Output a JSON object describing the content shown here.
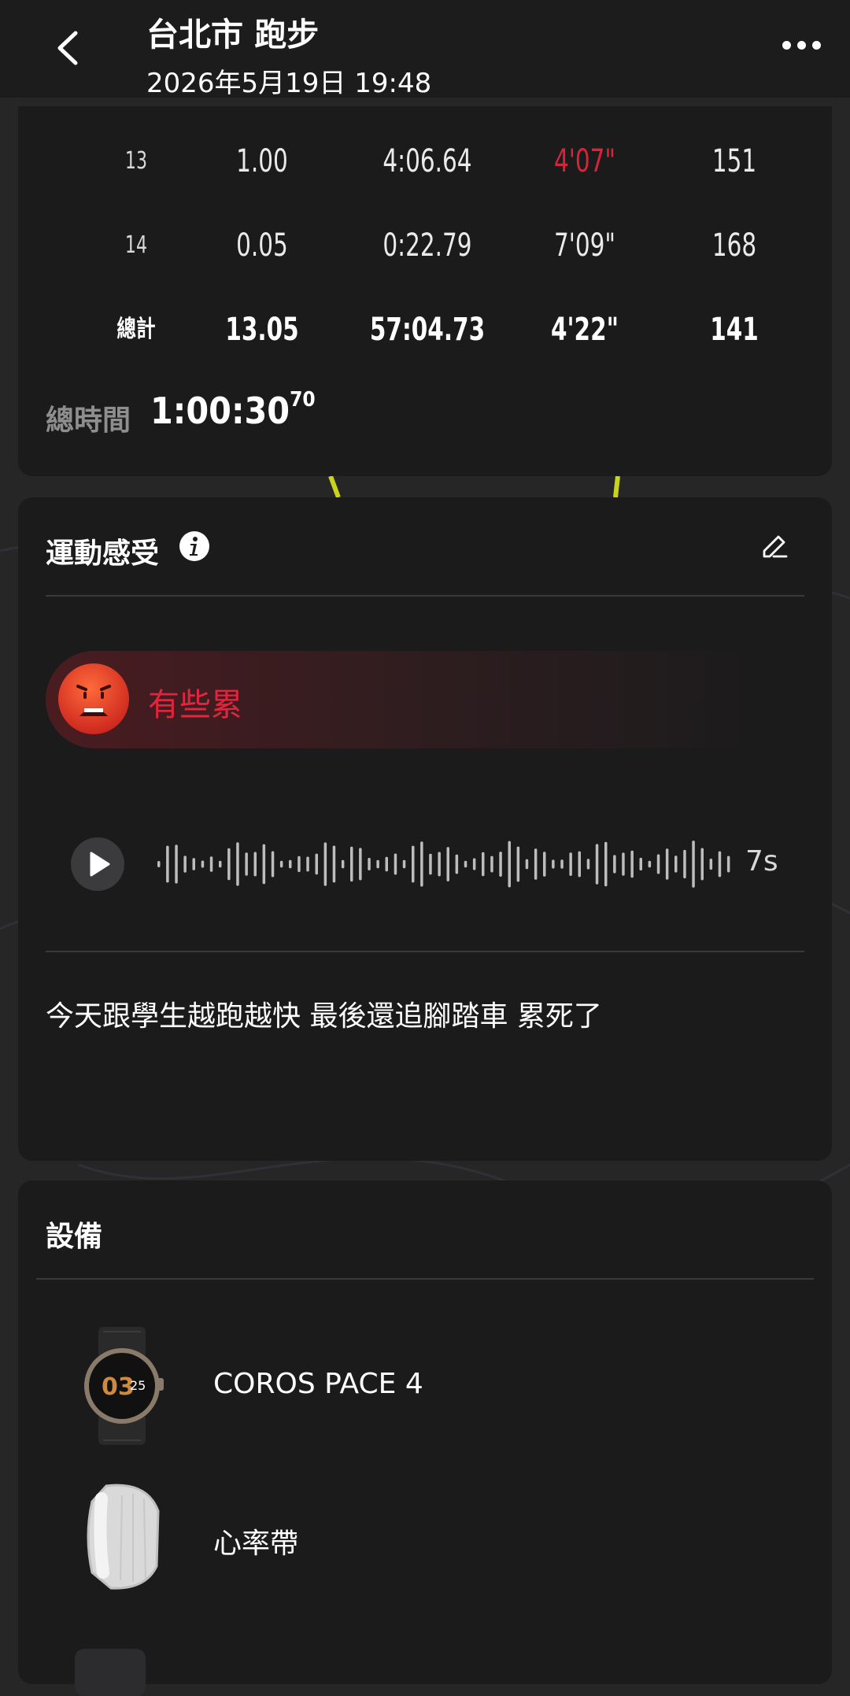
{
  "header": {
    "title": "台北市 跑步",
    "subtitle": "2026年5月19日 19:48"
  },
  "splits": {
    "rows": [
      {
        "lap": "13",
        "distance": "1.00",
        "time": "4:06.64",
        "pace": "4'07\"",
        "hr": "151",
        "pace_highlight": true
      },
      {
        "lap": "14",
        "distance": "0.05",
        "time": "0:22.79",
        "pace": "7'09\"",
        "hr": "168",
        "pace_highlight": false
      }
    ],
    "total": {
      "label": "總計",
      "distance": "13.05",
      "time": "57:04.73",
      "pace": "4'22\"",
      "hr": "141"
    },
    "total_time_label": "總時間",
    "total_time_value": "1:00:30",
    "total_time_fraction": "70",
    "highlight_color": "#d6243a"
  },
  "feeling": {
    "title": "運動感受",
    "mood_label": "有些累",
    "voice_duration": "7s",
    "note": "今天跟學生越跑越快 最後還追腳踏車 累死了"
  },
  "devices": {
    "title": "設備",
    "items": [
      {
        "name": "COROS PACE 4",
        "watch_face_text": "03",
        "watch_face_small": "25"
      },
      {
        "name": "心率帶"
      }
    ]
  }
}
